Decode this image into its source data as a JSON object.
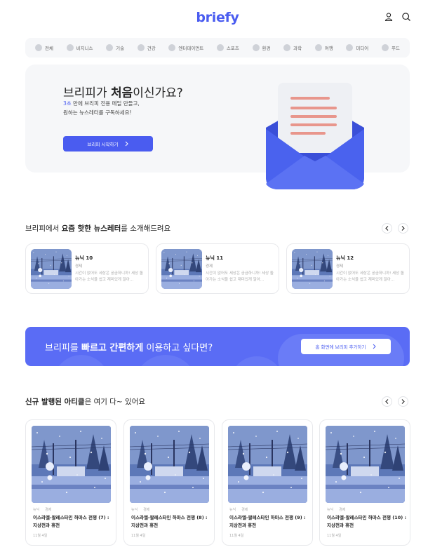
{
  "header": {
    "logo": "briefy",
    "user_icon": "user-icon",
    "search_icon": "search-icon"
  },
  "categories": [
    {
      "label": "전체",
      "icon": "globe-icon"
    },
    {
      "label": "비지니스",
      "icon": "chart-icon"
    },
    {
      "label": "기술",
      "icon": "wrench-icon"
    },
    {
      "label": "건강",
      "icon": "heart-icon"
    },
    {
      "label": "엔터테이먼트",
      "icon": "gamepad-icon"
    },
    {
      "label": "스포츠",
      "icon": "ball-icon"
    },
    {
      "label": "환경",
      "icon": "earth-icon"
    },
    {
      "label": "과학",
      "icon": "flask-icon"
    },
    {
      "label": "여행",
      "icon": "bag-icon"
    },
    {
      "label": "미디어",
      "icon": "media-icon"
    },
    {
      "label": "푸드",
      "icon": "food-icon"
    }
  ],
  "hero": {
    "title_pre": "브리피가 ",
    "title_bold": "처음",
    "title_post": "이신가요?",
    "sub_accent": "3초",
    "sub_line1_rest": " 만에 브리피 전용 메일 만들고,",
    "sub_line2": "원하는 뉴스레터를 구독하세요!",
    "button_label": "브리피 시작하기"
  },
  "newsletters_section": {
    "title_pre": "브리피에서 ",
    "title_bold": "요즘 핫한 뉴스레터",
    "title_post": "를 소개해드려요",
    "items": [
      {
        "name": "뉴닉 10",
        "category": "경제",
        "desc": "시간이 없어도 세상은 궁금하니까! 세상 돌아가는 소식을 쉽고 재미있게 알아..."
      },
      {
        "name": "뉴닉 11",
        "category": "경제",
        "desc": "시간이 없어도 세상은 궁금하니까! 세상 돌아가는 소식을 쉽고 재미있게 알아..."
      },
      {
        "name": "뉴닉 12",
        "category": "경제",
        "desc": "시간이 없어도 세상은 궁금하니까! 세상 돌아가는 소식을 쉽고 재미있게 알아..."
      }
    ]
  },
  "banner": {
    "text_pre": "브리피를 ",
    "text_bold": "빠르고 간편하게",
    "text_post": " 이용하고 싶다면?",
    "button_label": "홈 화면에 브리피 추가하기"
  },
  "articles_section": {
    "title_bold": "신규 발행된 아티클",
    "title_post": "은 여기 다~ 있어요",
    "items": [
      {
        "source": "뉴닉",
        "category": "경제",
        "title": "이스라엘-팔레스타인 하마스 전쟁 (7) : 지상전과 휴전",
        "date": "11월 4일"
      },
      {
        "source": "뉴닉",
        "category": "경제",
        "title": "이스라엘-팔레스타인 하마스 전쟁 (8) : 지상전과 휴전",
        "date": "11월 4일"
      },
      {
        "source": "뉴닉",
        "category": "경제",
        "title": "이스라엘-팔레스타인 하마스 전쟁 (9) : 지상전과 휴전",
        "date": "11월 4일"
      },
      {
        "source": "뉴닉",
        "category": "경제",
        "title": "이스라엘-팔레스타인 하마스 전쟁 (10) : 지상전과 휴전",
        "date": "11월 4일"
      }
    ]
  },
  "colors": {
    "accent": "#4a5cf0",
    "banner": "#5a6cf5",
    "surface": "#f6f7f9"
  }
}
